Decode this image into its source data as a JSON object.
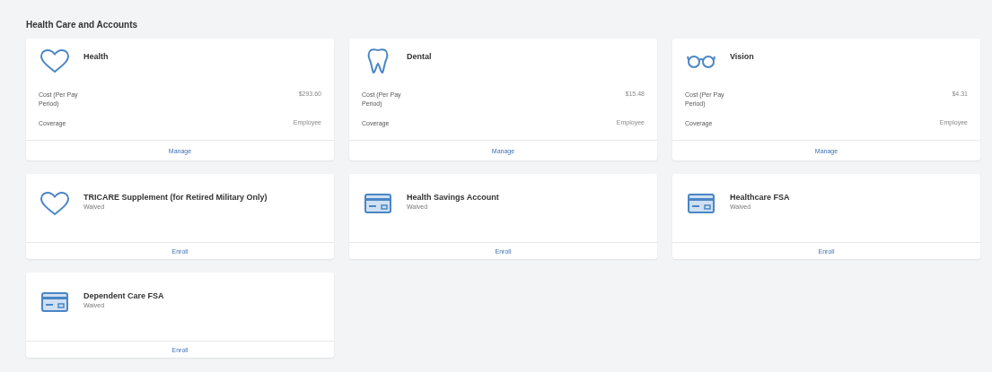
{
  "section": {
    "title": "Health Care and Accounts"
  },
  "cards": [
    {
      "kind": "plan",
      "title": "Health",
      "details": [
        {
          "label": "Cost (Per Pay Period)",
          "value": "$293.60"
        },
        {
          "label": "Coverage",
          "value": "Employee"
        }
      ],
      "action": "Manage"
    },
    {
      "kind": "plan",
      "title": "Dental",
      "details": [
        {
          "label": "Cost (Per Pay Period)",
          "value": "$15.48"
        },
        {
          "label": "Coverage",
          "value": "Employee"
        }
      ],
      "action": "Manage"
    },
    {
      "kind": "plan",
      "title": "Vision",
      "details": [
        {
          "label": "Cost (Per Pay Period)",
          "value": "$4.31"
        },
        {
          "label": "Coverage",
          "value": "Employee"
        }
      ],
      "action": "Manage"
    },
    {
      "kind": "account",
      "title": "TRICARE Supplement (for Retired Military Only)",
      "status": "Waived",
      "action": "Enroll"
    },
    {
      "kind": "account",
      "title": "Health Savings Account",
      "status": "Waived",
      "action": "Enroll"
    },
    {
      "kind": "account",
      "title": "Healthcare FSA",
      "status": "Waived",
      "action": "Enroll"
    },
    {
      "kind": "account",
      "title": "Dependent Care FSA",
      "status": "Waived",
      "action": "Enroll"
    }
  ]
}
